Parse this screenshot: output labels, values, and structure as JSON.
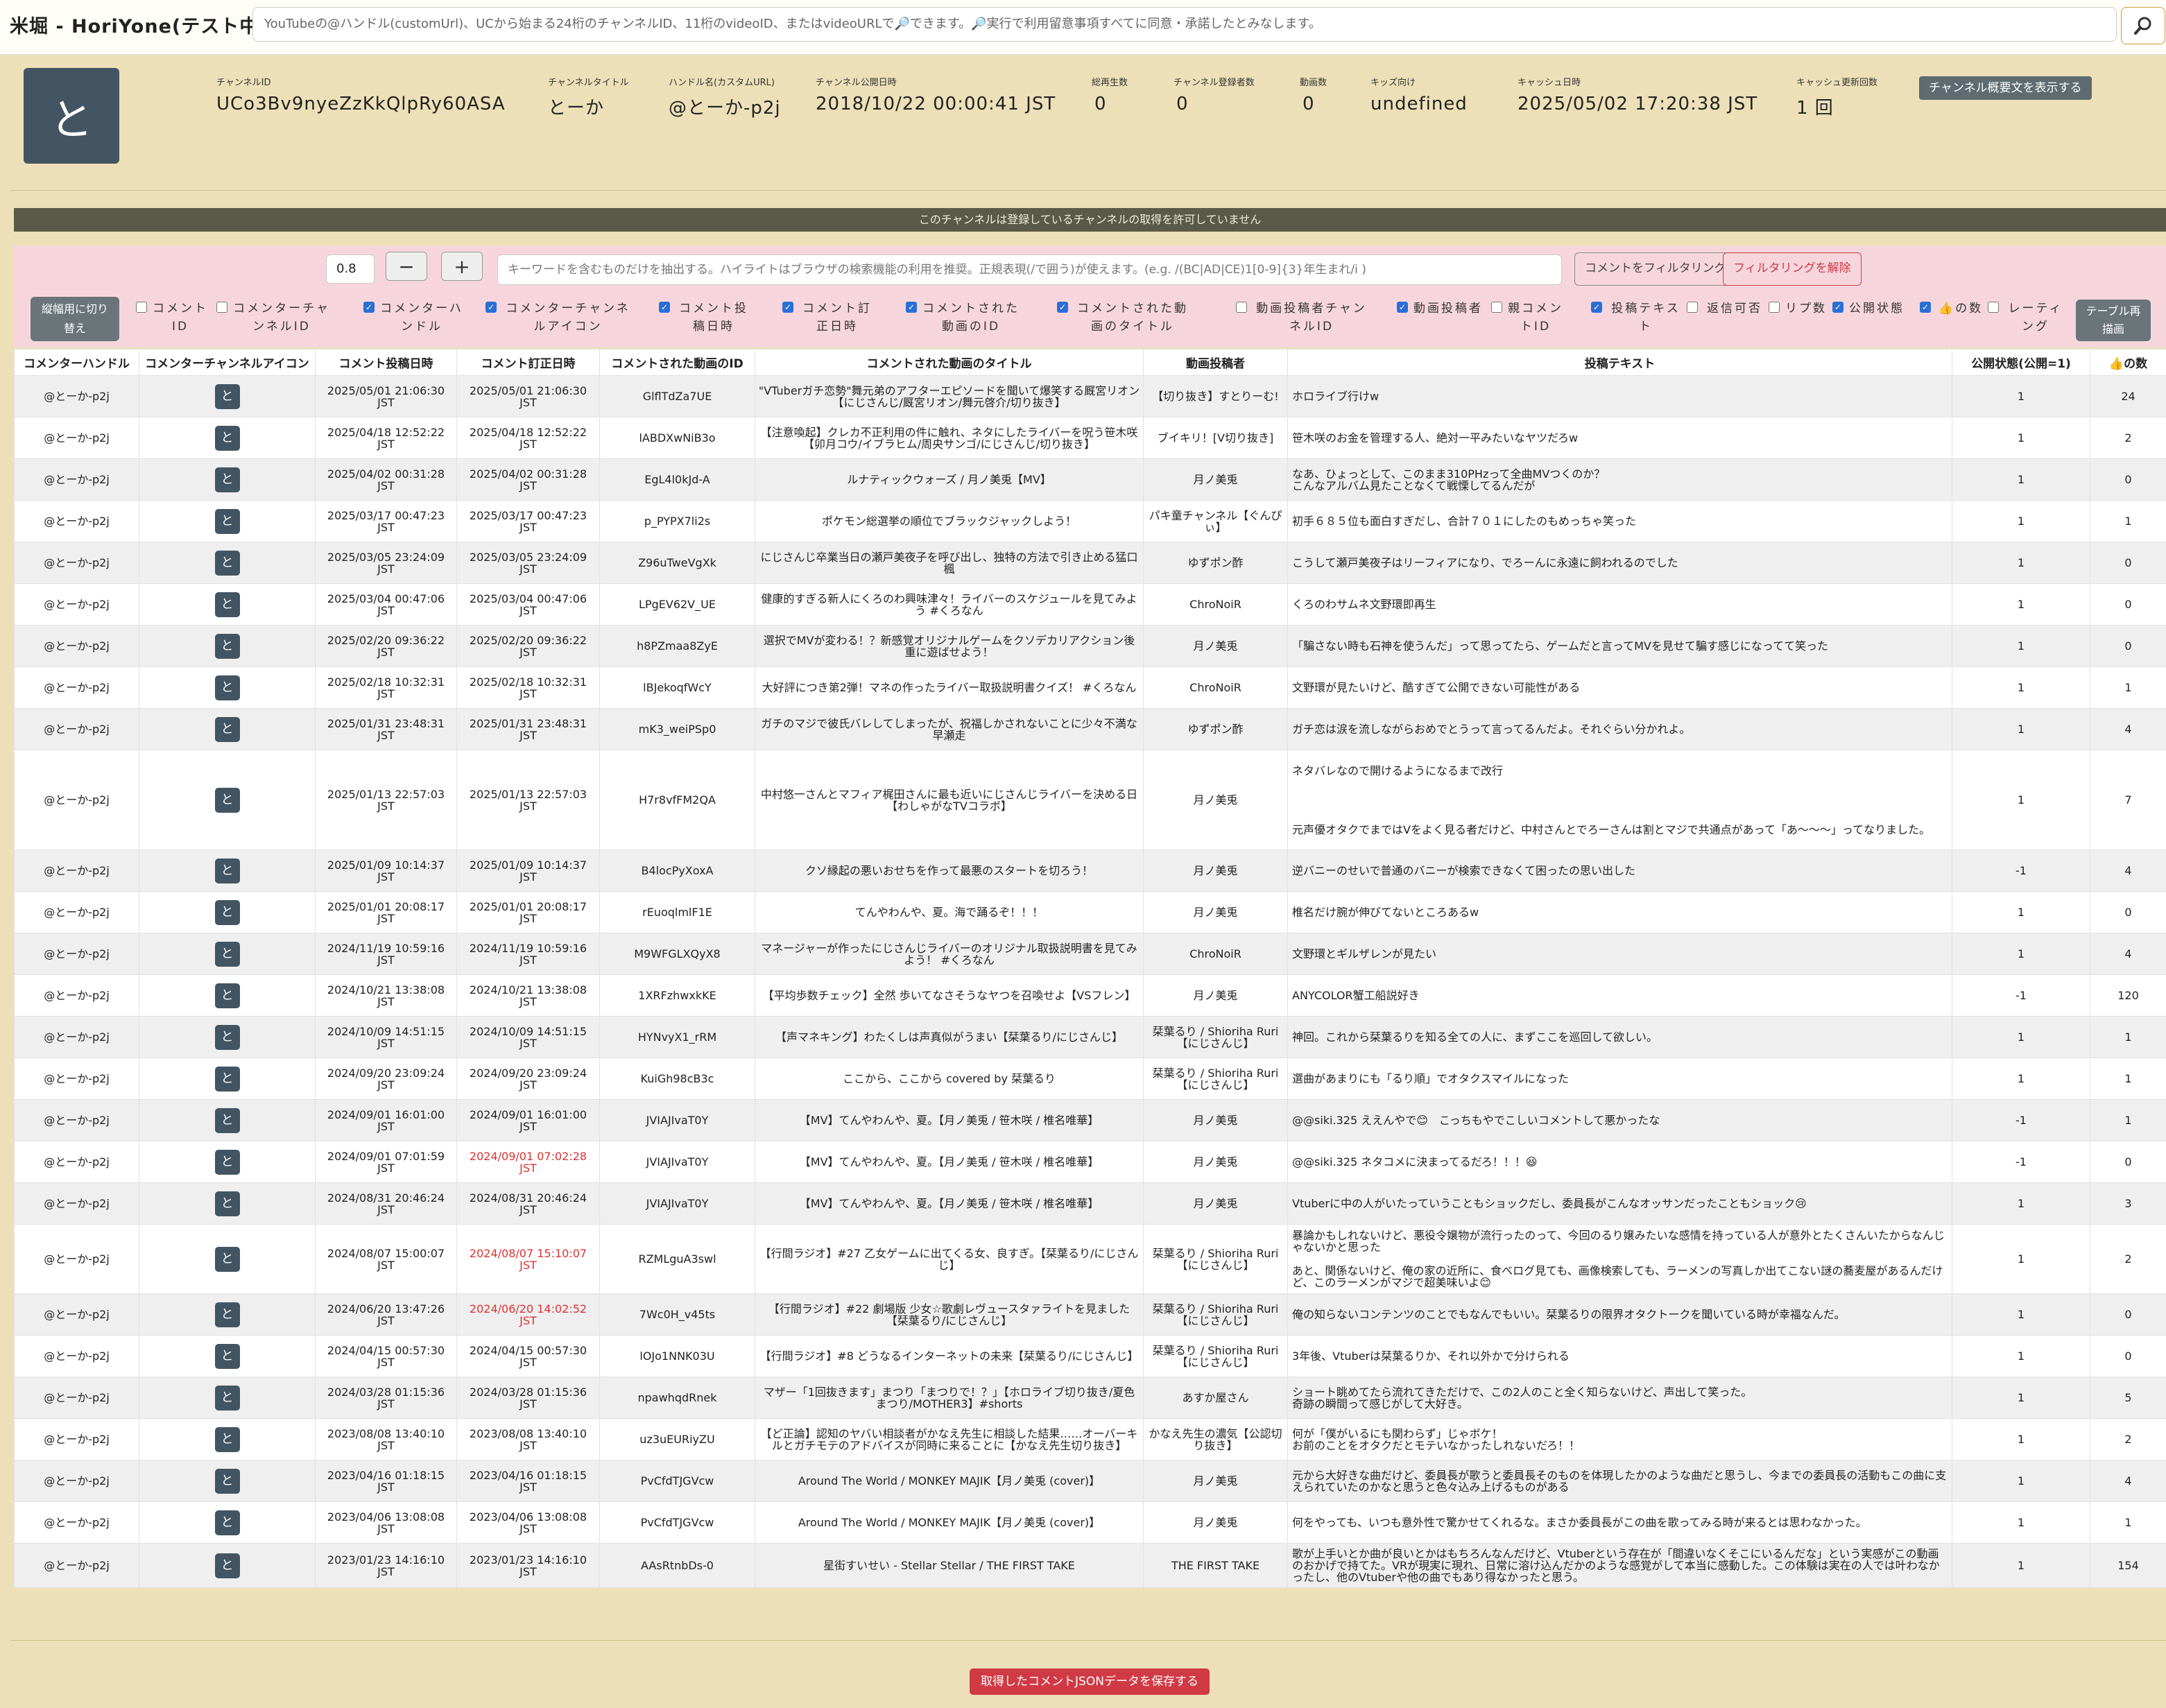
{
  "app": {
    "title": "米堀 - HoriYone(テスト中)"
  },
  "search": {
    "placeholder": "YouTubeの@ハンドル(customUrl)、UCから始まる24桁のチャンネルID、11桁のvideoID、またはvideoURLで🔎できます。🔎実行で利用留意事項すべてに同意・承諾したとみなします。"
  },
  "channel": {
    "avatar_char": "と",
    "id_label": "チャンネルID",
    "id": "UCo3Bv9nyeZzKkQlpRy60ASA",
    "title_label": "チャンネルタイトル",
    "title": "とーか",
    "handle_label": "ハンドル名(カスタムURL)",
    "handle": "@とーか-p2j",
    "published_label": "チャンネル公開日時",
    "published": "2018/10/22 00:00:41 JST",
    "views_label": "総再生数",
    "views": "0",
    "subs_label": "チャンネル登録者数",
    "subs": "0",
    "videos_label": "動画数",
    "videos": "0",
    "kids_label": "キッズ向け",
    "kids": "undefined",
    "cache_label": "キャッシュ日時",
    "cache": "2025/05/02 17:20:38 JST",
    "cache_count_label": "キャッシュ更新回数",
    "cache_count": "1 回",
    "desc_button": "チャンネル概要文を表示する"
  },
  "notice": "このチャンネルは登録しているチャンネルの取得を許可していません",
  "filter": {
    "threshold": "0.8",
    "minus": "−",
    "plus": "+",
    "keyword_placeholder": "キーワードを含むものだけを抽出する。ハイライトはブラウザの検索機能の利用を推奨。正規表現(/で囲う)が使えます。(e.g. /(BC|AD|CE)1[0-9]{3}年生まれ/i )",
    "apply": "コメントをフィルタリング",
    "clear": "フィルタリングを解除",
    "mobile_toggle": "縦幅用に切り替え",
    "redraw": "テーブル再描画",
    "columns": [
      {
        "label": "コメントID",
        "checked": false
      },
      {
        "label": "コメンターチャンネルID",
        "checked": false
      },
      {
        "label": "コメンターハンドル",
        "checked": true
      },
      {
        "label": "コメンターチャンネルアイコン",
        "checked": true
      },
      {
        "label": "コメント投稿日時",
        "checked": true
      },
      {
        "label": "コメント訂正日時",
        "checked": true
      },
      {
        "label": "コメントされた動画のID",
        "checked": true
      },
      {
        "label": "コメントされた動画のタイトル",
        "checked": true
      },
      {
        "label": "動画投稿者チャンネルID",
        "checked": false
      },
      {
        "label": "動画投稿者",
        "checked": true
      },
      {
        "label": "親コメントID",
        "checked": false
      },
      {
        "label": "投稿テキスト",
        "checked": true
      },
      {
        "label": "返信可否",
        "checked": false
      },
      {
        "label": "リプ数",
        "checked": false
      },
      {
        "label": "公開状態",
        "checked": true
      },
      {
        "label": "👍の数",
        "checked": true
      },
      {
        "label": "レーティング",
        "checked": false
      }
    ]
  },
  "table": {
    "headers": [
      "コメンターハンドル",
      "コメンターチャンネルアイコン",
      "コメント投稿日時",
      "コメント訂正日時",
      "コメントされた動画のID",
      "コメントされた動画のタイトル",
      "動画投稿者",
      "投稿テキスト",
      "公開状態(公開=1)",
      "👍の数"
    ],
    "rows": [
      {
        "handle": "@とーか-p2j",
        "icon": "と",
        "posted": "2025/05/01 21:06:30 JST",
        "edited": "2025/05/01 21:06:30 JST",
        "edited_red": false,
        "vid": "GlflTdZa7UE",
        "vtitle": "\"VTuberガチ恋勢\"舞元弟のアフターエピソードを聞いて爆笑する厩宮リオン【にじさんじ/厩宮リオン/舞元啓介/切り抜き】",
        "uploader": "【切り抜き】すとりーむ!",
        "text": "ホロライブ行けw",
        "status": "1",
        "likes": "24"
      },
      {
        "handle": "@とーか-p2j",
        "icon": "と",
        "posted": "2025/04/18 12:52:22 JST",
        "edited": "2025/04/18 12:52:22 JST",
        "edited_red": false,
        "vid": "lABDXwNiB3o",
        "vtitle": "【注意喚起】クレカ不正利用の件に触れ、ネタにしたライバーを呪う笹木咲【卯月コウ/イブラヒム/周央サンゴ/にじさんじ/切り抜き】",
        "uploader": "ブイキリ！[V切り抜き]",
        "text": "笹木咲のお金を管理する人、絶対一平みたいなヤツだろw",
        "status": "1",
        "likes": "2"
      },
      {
        "handle": "@とーか-p2j",
        "icon": "と",
        "posted": "2025/04/02 00:31:28 JST",
        "edited": "2025/04/02 00:31:28 JST",
        "edited_red": false,
        "vid": "EgL4l0kJd-A",
        "vtitle": "ルナティックウォーズ / 月ノ美兎【MV】",
        "uploader": "月ノ美兎",
        "text": "なあ、ひょっとして、このまま310PHzって全曲MVつくのか？\nこんなアルバム見たことなくて戦慄してるんだが",
        "status": "1",
        "likes": "0"
      },
      {
        "handle": "@とーか-p2j",
        "icon": "と",
        "posted": "2025/03/17 00:47:23 JST",
        "edited": "2025/03/17 00:47:23 JST",
        "edited_red": false,
        "vid": "p_PYPX7li2s",
        "vtitle": "ポケモン総選挙の順位でブラックジャックしよう！",
        "uploader": "パキ童チャンネル【ぐんぴぃ】",
        "text": "初手６８５位も面白すぎだし、合計７０１にしたのもめっちゃ笑った",
        "status": "1",
        "likes": "1"
      },
      {
        "handle": "@とーか-p2j",
        "icon": "と",
        "posted": "2025/03/05 23:24:09 JST",
        "edited": "2025/03/05 23:24:09 JST",
        "edited_red": false,
        "vid": "Z96uTweVgXk",
        "vtitle": "にじさんじ卒業当日の瀬戸美夜子を呼び出し、独特の方法で引き止める猛口楓",
        "uploader": "ゆずポン酢",
        "text": "こうして瀬戸美夜子はリーフィアになり、でろーんに永遠に飼われるのでした",
        "status": "1",
        "likes": "0"
      },
      {
        "handle": "@とーか-p2j",
        "icon": "と",
        "posted": "2025/03/04 00:47:06 JST",
        "edited": "2025/03/04 00:47:06 JST",
        "edited_red": false,
        "vid": "LPgEV62V_UE",
        "vtitle": "健康的すぎる新人にくろのわ興味津々！ライバーのスケジュールを見てみよう #くろなん",
        "uploader": "ChroNoiR",
        "text": "くろのわサムネ文野環即再生",
        "status": "1",
        "likes": "0"
      },
      {
        "handle": "@とーか-p2j",
        "icon": "と",
        "posted": "2025/02/20 09:36:22 JST",
        "edited": "2025/02/20 09:36:22 JST",
        "edited_red": false,
        "vid": "h8PZmaa8ZyE",
        "vtitle": "選択でMVが変わる！？新感覚オリジナルゲームをクソデカリアクション後重に遊ばせよう！",
        "uploader": "月ノ美兎",
        "text": "「騙さない時も石神を使うんだ」って思ってたら、ゲームだと言ってMVを見せて騙す感じになってて笑った",
        "status": "1",
        "likes": "0"
      },
      {
        "handle": "@とーか-p2j",
        "icon": "と",
        "posted": "2025/02/18 10:32:31 JST",
        "edited": "2025/02/18 10:32:31 JST",
        "edited_red": false,
        "vid": "lBJekoqfWcY",
        "vtitle": "大好評につき第2弾！マネの作ったライバー取扱説明書クイズ！ #くろなん",
        "uploader": "ChroNoiR",
        "text": "文野環が見たいけど、酷すぎて公開できない可能性がある",
        "status": "1",
        "likes": "1"
      },
      {
        "handle": "@とーか-p2j",
        "icon": "と",
        "posted": "2025/01/31 23:48:31 JST",
        "edited": "2025/01/31 23:48:31 JST",
        "edited_red": false,
        "vid": "mK3_weiPSp0",
        "vtitle": "ガチのマジで彼氏バレしてしまったが、祝福しかされないことに少々不満な早瀬走",
        "uploader": "ゆずポン酢",
        "text": "ガチ恋は涙を流しながらおめでとうって言ってるんだよ。それぐらい分かれよ。",
        "status": "1",
        "likes": "4"
      },
      {
        "handle": "@とーか-p2j",
        "icon": "と",
        "posted": "2025/01/13 22:57:03 JST",
        "edited": "2025/01/13 22:57:03 JST",
        "edited_red": false,
        "vid": "H7r8vfFM2QA",
        "vtitle": "中村悠一さんとマフィア梶田さんに最も近いにじさんじライバーを決める日【わしゃがなTVコラボ】",
        "uploader": "月ノ美兎",
        "text": "ネタバレなので開けるようになるまで改行\n\n\n\n\n元声優オタクでまではVをよく見る者だけど、中村さんとでろーさんは割とマジで共通点があって「あ〜〜〜」ってなりました。",
        "status": "1",
        "likes": "7",
        "tall": true
      },
      {
        "handle": "@とーか-p2j",
        "icon": "と",
        "posted": "2025/01/09 10:14:37 JST",
        "edited": "2025/01/09 10:14:37 JST",
        "edited_red": false,
        "vid": "B4locPyXoxA",
        "vtitle": "クソ縁起の悪いおせちを作って最悪のスタートを切ろう！",
        "uploader": "月ノ美兎",
        "text": "逆バニーのせいで普通のバニーが検索できなくて困ったの思い出した",
        "status": "-1",
        "likes": "4"
      },
      {
        "handle": "@とーか-p2j",
        "icon": "と",
        "posted": "2025/01/01 20:08:17 JST",
        "edited": "2025/01/01 20:08:17 JST",
        "edited_red": false,
        "vid": "rEuoqlmlF1E",
        "vtitle": "てんやわんや、夏。海で踊るぞ！！！",
        "uploader": "月ノ美兎",
        "text": "椎名だけ腕が伸びてないところあるw",
        "status": "1",
        "likes": "0"
      },
      {
        "handle": "@とーか-p2j",
        "icon": "と",
        "posted": "2024/11/19 10:59:16 JST",
        "edited": "2024/11/19 10:59:16 JST",
        "edited_red": false,
        "vid": "M9WFGLXQyX8",
        "vtitle": "マネージャーが作ったにじさんじライバーのオリジナル取扱説明書を見てみよう！ #くろなん",
        "uploader": "ChroNoiR",
        "text": "文野環とギルザレンが見たい",
        "status": "1",
        "likes": "4"
      },
      {
        "handle": "@とーか-p2j",
        "icon": "と",
        "posted": "2024/10/21 13:38:08 JST",
        "edited": "2024/10/21 13:38:08 JST",
        "edited_red": false,
        "vid": "1XRFzhwxkKE",
        "vtitle": "【平均歩数チェック】全然 歩いてなさそうなヤつを召喚せよ【VSフレン】",
        "uploader": "月ノ美兎",
        "text": "ANYCOLOR蟹工船説好き",
        "status": "-1",
        "likes": "120"
      },
      {
        "handle": "@とーか-p2j",
        "icon": "と",
        "posted": "2024/10/09 14:51:15 JST",
        "edited": "2024/10/09 14:51:15 JST",
        "edited_red": false,
        "vid": "HYNvyX1_rRM",
        "vtitle": "【声マネキング】わたくしは声真似がうまい【栞葉るり/にじさんじ】",
        "uploader": "栞葉るり / Shioriha Ruri【にじさんじ】",
        "text": "神回。これから栞葉るりを知る全ての人に、まずここを巡回して欲しい。",
        "status": "1",
        "likes": "1"
      },
      {
        "handle": "@とーか-p2j",
        "icon": "と",
        "posted": "2024/09/20 23:09:24 JST",
        "edited": "2024/09/20 23:09:24 JST",
        "edited_red": false,
        "vid": "KuiGh98cB3c",
        "vtitle": "ここから、ここから covered by 栞葉るり",
        "uploader": "栞葉るり / Shioriha Ruri【にじさんじ】",
        "text": "選曲があまりにも「るり順」でオタクスマイルになった",
        "status": "1",
        "likes": "1"
      },
      {
        "handle": "@とーか-p2j",
        "icon": "と",
        "posted": "2024/09/01 16:01:00 JST",
        "edited": "2024/09/01 16:01:00 JST",
        "edited_red": false,
        "vid": "JVIAJIvaT0Y",
        "vtitle": "【MV】てんやわんや、夏。【月ノ美兎 / 笹木咲 / 椎名唯華】",
        "uploader": "月ノ美兎",
        "text": "@@siki.325 ええんやで😊　こっちもやでこしいコメントして悪かったな",
        "status": "-1",
        "likes": "1"
      },
      {
        "handle": "@とーか-p2j",
        "icon": "と",
        "posted": "2024/09/01 07:01:59 JST",
        "edited": "2024/09/01 07:02:28 JST",
        "edited_red": true,
        "vid": "JVIAJIvaT0Y",
        "vtitle": "【MV】てんやわんや、夏。【月ノ美兎 / 笹木咲 / 椎名唯華】",
        "uploader": "月ノ美兎",
        "text": "@@siki.325 ネタコメに決まってるだろ！！！😆",
        "status": "-1",
        "likes": "0"
      },
      {
        "handle": "@とーか-p2j",
        "icon": "と",
        "posted": "2024/08/31 20:46:24 JST",
        "edited": "2024/08/31 20:46:24 JST",
        "edited_red": false,
        "vid": "JVIAJIvaT0Y",
        "vtitle": "【MV】てんやわんや、夏。【月ノ美兎 / 笹木咲 / 椎名唯華】",
        "uploader": "月ノ美兎",
        "text": "Vtuberに中の人がいたっていうこともショックだし、委員長がこんなオッサンだったこともショック😢",
        "status": "1",
        "likes": "3"
      },
      {
        "handle": "@とーか-p2j",
        "icon": "と",
        "posted": "2024/08/07 15:00:07 JST",
        "edited": "2024/08/07 15:10:07 JST",
        "edited_red": true,
        "vid": "RZMLguA3swl",
        "vtitle": "【行間ラジオ】#27 乙女ゲームに出てくる女、良すぎ。【栞葉るり/にじさんじ】",
        "uploader": "栞葉るり / Shioriha Ruri【にじさんじ】",
        "text": "暴論かもしれないけど、悪役令嬢物が流行ったのって、今回のるり嬢みたいな感情を持っている人が意外とたくさんいたからなんじゃないかと思った\n\nあと、関係ないけど、俺の家の近所に、食べログ見ても、画像検索しても、ラーメンの写真しか出てこない謎の蕎麦屋があるんだけど、このラーメンがマジで超美味いよ😊",
        "status": "1",
        "likes": "2",
        "tall2": true
      },
      {
        "handle": "@とーか-p2j",
        "icon": "と",
        "posted": "2024/06/20 13:47:26 JST",
        "edited": "2024/06/20 14:02:52 JST",
        "edited_red": true,
        "vid": "7Wc0H_v45ts",
        "vtitle": "【行間ラジオ】#22 劇場版 少女☆歌劇レヴュースタァライトを見ました【栞葉るり/にじさんじ】",
        "uploader": "栞葉るり / Shioriha Ruri【にじさんじ】",
        "text": "俺の知らないコンテンツのことでもなんでもいい。栞葉るりの限界オタクトークを聞いている時が幸福なんだ。",
        "status": "1",
        "likes": "0"
      },
      {
        "handle": "@とーか-p2j",
        "icon": "と",
        "posted": "2024/04/15 00:57:30 JST",
        "edited": "2024/04/15 00:57:30 JST",
        "edited_red": false,
        "vid": "lOJo1NNK03U",
        "vtitle": "【行間ラジオ】#8 どうなるインターネットの未来【栞葉るり/にじさんじ】",
        "uploader": "栞葉るり / Shioriha Ruri【にじさんじ】",
        "text": "3年後、Vtuberは栞葉るりか、それ以外かで分けられる",
        "status": "1",
        "likes": "0"
      },
      {
        "handle": "@とーか-p2j",
        "icon": "と",
        "posted": "2024/03/28 01:15:36 JST",
        "edited": "2024/03/28 01:15:36 JST",
        "edited_red": false,
        "vid": "npawhqdRnek",
        "vtitle": "マザー「1回抜きます」まつり「まつりで！？」【ホロライブ切り抜き/夏色まつり/MOTHER3】#shorts",
        "uploader": "あすか屋さん",
        "text": "ショート眺めてたら流れてきただけで、この2人のこと全く知らないけど、声出して笑った。\n奇跡の瞬間って感じがして大好き。",
        "status": "1",
        "likes": "5"
      },
      {
        "handle": "@とーか-p2j",
        "icon": "と",
        "posted": "2023/08/08 13:40:10 JST",
        "edited": "2023/08/08 13:40:10 JST",
        "edited_red": false,
        "vid": "uz3uEURiyZU",
        "vtitle": "【ど正論】認知のヤバい相談者がかなえ先生に相談した結果……オーバーキルとガチモテのアドバイスが同時に来ることに【かなえ先生切り抜き】",
        "uploader": "かなえ先生の濃気【公認切り抜き】",
        "text": "何が「僕がいるにも関わらず」じゃボケ！\nお前のことをオタクだとモテいなかったしれないだろ！！",
        "status": "1",
        "likes": "2"
      },
      {
        "handle": "@とーか-p2j",
        "icon": "と",
        "posted": "2023/04/16 01:18:15 JST",
        "edited": "2023/04/16 01:18:15 JST",
        "edited_red": false,
        "vid": "PvCfdTJGVcw",
        "vtitle": "Around The World / MONKEY MAJIK【月ノ美兎 (cover)】",
        "uploader": "月ノ美兎",
        "text": "元から大好きな曲だけど、委員長が歌うと委員長そのものを体現したかのような曲だと思うし、今までの委員長の活動もこの曲に支えられていたのかなと思うと色々込み上げるものがある",
        "status": "1",
        "likes": "4"
      },
      {
        "handle": "@とーか-p2j",
        "icon": "と",
        "posted": "2023/04/06 13:08:08 JST",
        "edited": "2023/04/06 13:08:08 JST",
        "edited_red": false,
        "vid": "PvCfdTJGVcw",
        "vtitle": "Around The World / MONKEY MAJIK【月ノ美兎 (cover)】",
        "uploader": "月ノ美兎",
        "text": "何をやっても、いつも意外性で驚かせてくれるな。まさか委員長がこの曲を歌ってみる時が来るとは思わなかった。",
        "status": "1",
        "likes": "1"
      },
      {
        "handle": "@とーか-p2j",
        "icon": "と",
        "posted": "2023/01/23 14:16:10 JST",
        "edited": "2023/01/23 14:16:10 JST",
        "edited_red": false,
        "vid": "AAsRtnbDs-0",
        "vtitle": "星街すいせい - Stellar Stellar / THE FIRST TAKE",
        "uploader": "THE FIRST TAKE",
        "text": "歌が上手いとか曲が良いとかはもちろんなんだけど、Vtuberという存在が「間違いなくそこにいるんだな」という実感がこの動画のおかげで持てた。VRが現実に現れ、日常に溶け込んだかのような感覚がして本当に感動した。この体験は実在の人では叶わなかったし、他のVtuberや他の曲でもあり得なかったと思う。",
        "status": "1",
        "likes": "154"
      }
    ]
  },
  "save_button": "取得したコメントJSONデータを保存する"
}
